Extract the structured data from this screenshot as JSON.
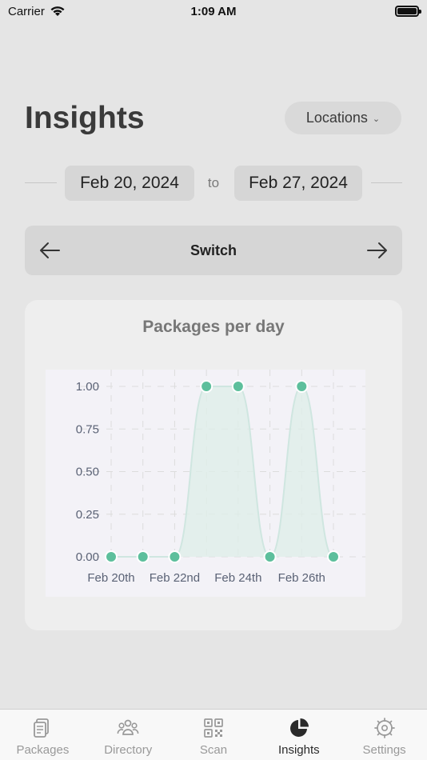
{
  "status": {
    "carrier": "Carrier",
    "time": "1:09 AM"
  },
  "header": {
    "title": "Insights",
    "locations_label": "Locations"
  },
  "date_range": {
    "start": "Feb 20, 2024",
    "separator": "to",
    "end": "Feb 27, 2024"
  },
  "switcher": {
    "label": "Switch"
  },
  "chart_card": {
    "title": "Packages per day"
  },
  "chart_data": {
    "type": "area",
    "title": "Packages per day",
    "x": [
      "Feb 20th",
      "Feb 21st",
      "Feb 22nd",
      "Feb 23rd",
      "Feb 24th",
      "Feb 25th",
      "Feb 26th",
      "Feb 27th"
    ],
    "x_tick_labels": [
      "Feb 20th",
      "Feb 22nd",
      "Feb 24th",
      "Feb 26th"
    ],
    "values": [
      0,
      0,
      0,
      1,
      1,
      0,
      1,
      0
    ],
    "y_ticks": [
      "0.00",
      "0.25",
      "0.50",
      "0.75",
      "1.00"
    ],
    "ylim": [
      0,
      1
    ],
    "grid": true,
    "colors": {
      "line": "#cfe6e0",
      "fill": "#deede9",
      "point": "#5dbf9c"
    }
  },
  "tabs": [
    {
      "label": "Packages",
      "icon": "packages-icon"
    },
    {
      "label": "Directory",
      "icon": "people-icon"
    },
    {
      "label": "Scan",
      "icon": "qr-code-icon"
    },
    {
      "label": "Insights",
      "icon": "pie-chart-icon",
      "active": true
    },
    {
      "label": "Settings",
      "icon": "gear-icon"
    }
  ]
}
